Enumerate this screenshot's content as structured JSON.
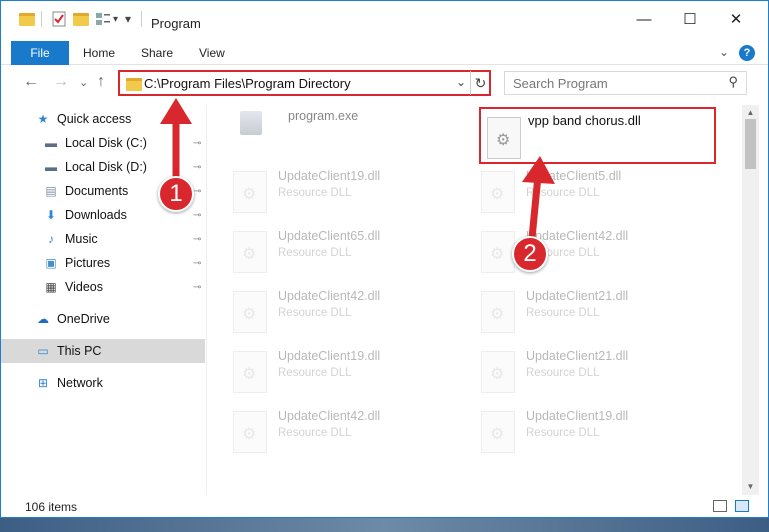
{
  "window": {
    "title": "Program",
    "minimize_glyph": "—",
    "maximize_glyph": "☐",
    "close_glyph": "✕"
  },
  "quick_access_toolbar": {
    "customize_glyph": "▾"
  },
  "ribbon": {
    "file_label": "File",
    "tabs": [
      "Home",
      "Share",
      "View"
    ],
    "collapse_glyph": "⌄",
    "help_glyph": "?"
  },
  "navigation": {
    "back_glyph": "←",
    "forward_glyph": "→",
    "recent_glyph": "⌄",
    "up_glyph": "↑",
    "address": "C:\\Program Files\\Program Directory",
    "address_dropdown_glyph": "⌄",
    "refresh_glyph": "↻",
    "search_placeholder": "Search Program",
    "search_glyph": "⚲"
  },
  "sidebar": {
    "items": [
      {
        "label": "Quick access",
        "icon": "star-icon",
        "glyph": "★",
        "color": "#2f86d6",
        "pinned": false
      },
      {
        "label": "Local Disk (C:)",
        "icon": "drive-icon",
        "glyph": "▬",
        "color": "#5a6f84",
        "pinned": true
      },
      {
        "label": "Local Disk (D:)",
        "icon": "drive-icon",
        "glyph": "▬",
        "color": "#5a6f84",
        "pinned": true
      },
      {
        "label": "Documents",
        "icon": "documents-icon",
        "glyph": "▤",
        "color": "#7c8fa6",
        "pinned": true
      },
      {
        "label": "Downloads",
        "icon": "download-icon",
        "glyph": "⬇",
        "color": "#2f86d6",
        "pinned": true
      },
      {
        "label": "Music",
        "icon": "music-icon",
        "glyph": "♪",
        "color": "#2f86d6",
        "pinned": true
      },
      {
        "label": "Pictures",
        "icon": "pictures-icon",
        "glyph": "▣",
        "color": "#4a90c8",
        "pinned": true
      },
      {
        "label": "Videos",
        "icon": "videos-icon",
        "glyph": "▦",
        "color": "#444",
        "pinned": true
      },
      {
        "label": "OneDrive",
        "icon": "cloud-icon",
        "glyph": "☁",
        "color": "#1e6bc4",
        "pinned": false
      },
      {
        "label": "This PC",
        "icon": "computer-icon",
        "glyph": "▭",
        "color": "#2f86d6",
        "pinned": false,
        "selected": true
      },
      {
        "label": "Network",
        "icon": "network-icon",
        "glyph": "⊞",
        "color": "#2f86d6",
        "pinned": false
      }
    ],
    "pin_glyph": "📌"
  },
  "files": {
    "program_exe": "program.exe",
    "highlighted_file": "vpp band chorus.dll",
    "resource_label": "Resource DLL",
    "left_column": [
      "UpdateClient19.dll",
      "UpdateClient65.dll",
      "UpdateClient42.dll",
      "UpdateClient19.dll",
      "UpdateClient42.dll"
    ],
    "right_column": [
      "UpdateClient5.dll",
      "UpdateClient42.dll",
      "UpdateClient21.dll",
      "UpdateClient21.dll",
      "UpdateClient19.dll"
    ],
    "gear_glyph": "⚙"
  },
  "scrollbar": {
    "up_glyph": "▲",
    "down_glyph": "▼"
  },
  "status": {
    "item_count": "106 items"
  },
  "annotations": {
    "step1": "1",
    "step2": "2",
    "accent_color": "#d9272e"
  }
}
